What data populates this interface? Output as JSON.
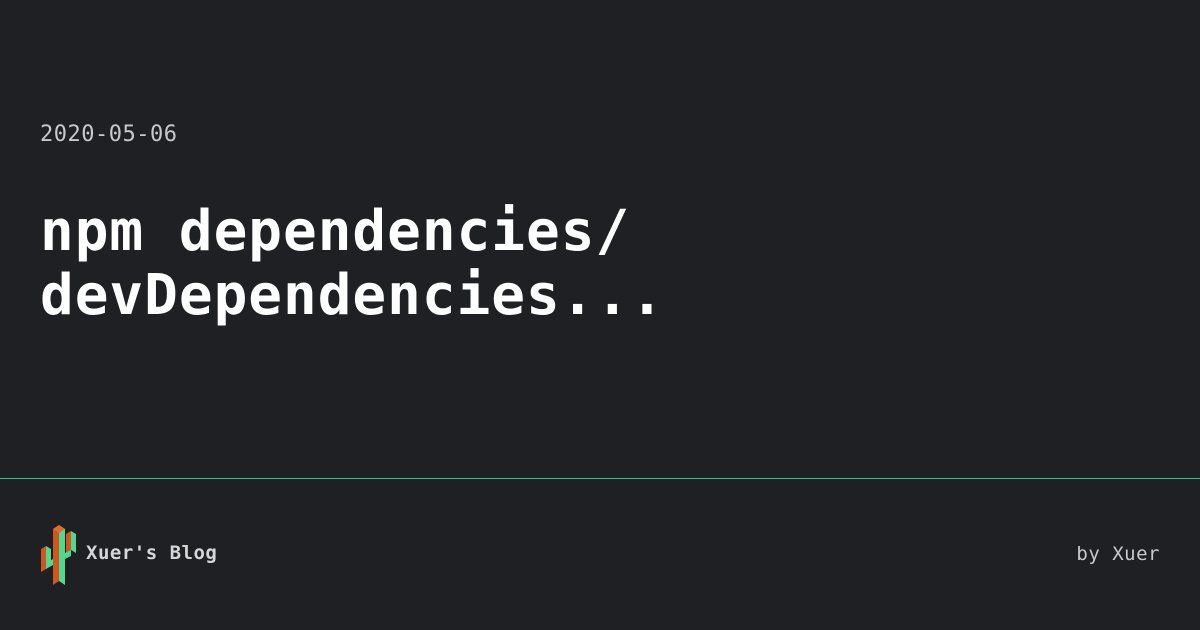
{
  "post": {
    "date": "2020-05-06",
    "title_lines": [
      "npm dependencies/",
      "devDependencies..."
    ]
  },
  "footer": {
    "brand_icon": "cactus-logo-icon",
    "brand_name": "Xuer's Blog",
    "byline": "by Xuer"
  },
  "colors": {
    "background": "#1f2023",
    "divider": "#3dbb86",
    "logo_green": "#4fd98f",
    "logo_orange": "#d3541f"
  }
}
